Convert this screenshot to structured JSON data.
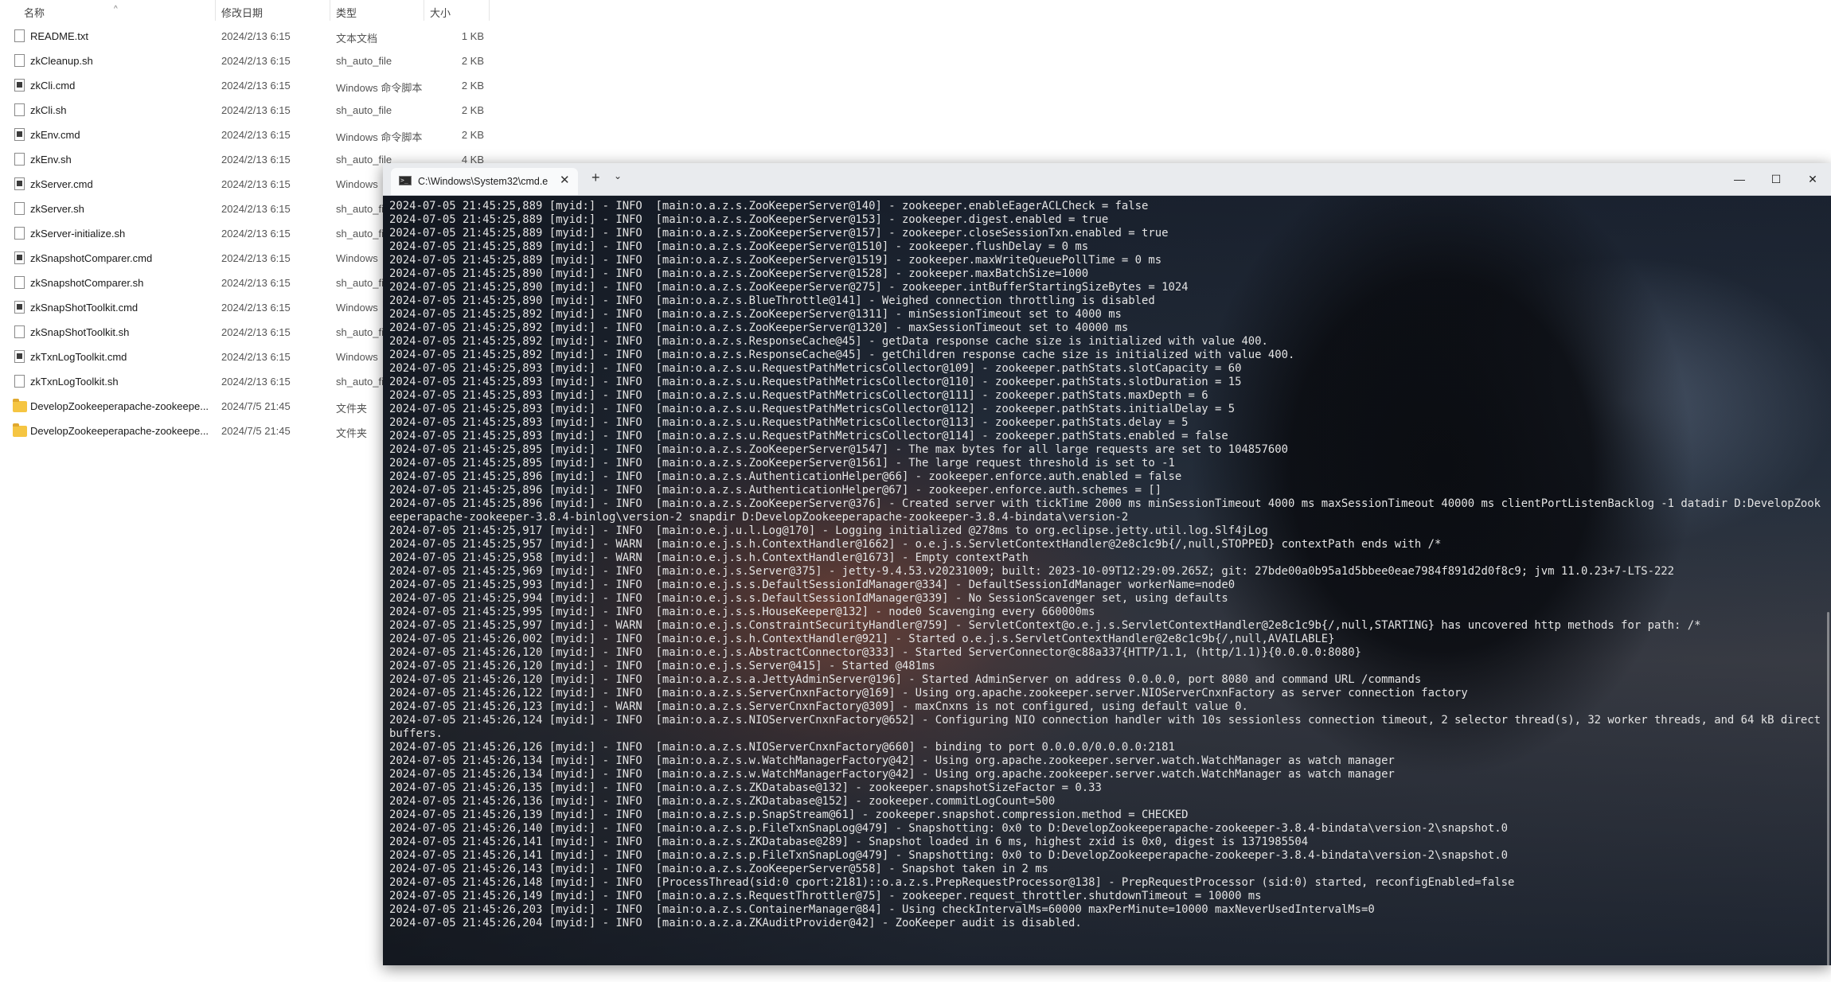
{
  "explorer": {
    "columns": {
      "name": "名称",
      "date": "修改日期",
      "type": "类型",
      "size": "大小"
    },
    "sort_indicator": "^",
    "files": [
      {
        "icon": "text-file-icon",
        "name": "README.txt",
        "date": "2024/2/13 6:15",
        "type": "文本文档",
        "size": "1 KB"
      },
      {
        "icon": "file-icon",
        "name": "zkCleanup.sh",
        "date": "2024/2/13 6:15",
        "type": "sh_auto_file",
        "size": "2 KB"
      },
      {
        "icon": "cmd-file-icon",
        "name": "zkCli.cmd",
        "date": "2024/2/13 6:15",
        "type": "Windows 命令脚本",
        "size": "2 KB"
      },
      {
        "icon": "file-icon",
        "name": "zkCli.sh",
        "date": "2024/2/13 6:15",
        "type": "sh_auto_file",
        "size": "2 KB"
      },
      {
        "icon": "cmd-file-icon",
        "name": "zkEnv.cmd",
        "date": "2024/2/13 6:15",
        "type": "Windows 命令脚本",
        "size": "2 KB"
      },
      {
        "icon": "file-icon",
        "name": "zkEnv.sh",
        "date": "2024/2/13 6:15",
        "type": "sh_auto_file",
        "size": "4 KB"
      },
      {
        "icon": "cmd-file-icon",
        "name": "zkServer.cmd",
        "date": "2024/2/13 6:15",
        "type": "Windows",
        "size": ""
      },
      {
        "icon": "file-icon",
        "name": "zkServer.sh",
        "date": "2024/2/13 6:15",
        "type": "sh_auto_fi",
        "size": ""
      },
      {
        "icon": "file-icon",
        "name": "zkServer-initialize.sh",
        "date": "2024/2/13 6:15",
        "type": "sh_auto_fi",
        "size": ""
      },
      {
        "icon": "cmd-file-icon",
        "name": "zkSnapshotComparer.cmd",
        "date": "2024/2/13 6:15",
        "type": "Windows",
        "size": ""
      },
      {
        "icon": "file-icon",
        "name": "zkSnapshotComparer.sh",
        "date": "2024/2/13 6:15",
        "type": "sh_auto_fi",
        "size": ""
      },
      {
        "icon": "cmd-file-icon",
        "name": "zkSnapShotToolkit.cmd",
        "date": "2024/2/13 6:15",
        "type": "Windows",
        "size": ""
      },
      {
        "icon": "file-icon",
        "name": "zkSnapShotToolkit.sh",
        "date": "2024/2/13 6:15",
        "type": "sh_auto_fi",
        "size": ""
      },
      {
        "icon": "cmd-file-icon",
        "name": "zkTxnLogToolkit.cmd",
        "date": "2024/2/13 6:15",
        "type": "Windows",
        "size": ""
      },
      {
        "icon": "file-icon",
        "name": "zkTxnLogToolkit.sh",
        "date": "2024/2/13 6:15",
        "type": "sh_auto_fi",
        "size": ""
      },
      {
        "icon": "folder-icon",
        "name": "DevelopZookeeperapache-zookeepe...",
        "date": "2024/7/5 21:45",
        "type": "文件夹",
        "size": ""
      },
      {
        "icon": "folder-icon",
        "name": "DevelopZookeeperapache-zookeepe...",
        "date": "2024/7/5 21:45",
        "type": "文件夹",
        "size": ""
      }
    ]
  },
  "terminal": {
    "tab_icon_glyph": ">_",
    "tab_title": "C:\\Windows\\System32\\cmd.e",
    "tab_close": "✕",
    "new_tab": "+",
    "dropdown": "⌄",
    "minimize": "—",
    "maximize": "☐",
    "close": "✕",
    "lines": [
      "2024-07-05 21:45:25,889 [myid:] - INFO  [main:o.a.z.s.ZooKeeperServer@140] - zookeeper.enableEagerACLCheck = false",
      "2024-07-05 21:45:25,889 [myid:] - INFO  [main:o.a.z.s.ZooKeeperServer@153] - zookeeper.digest.enabled = true",
      "2024-07-05 21:45:25,889 [myid:] - INFO  [main:o.a.z.s.ZooKeeperServer@157] - zookeeper.closeSessionTxn.enabled = true",
      "2024-07-05 21:45:25,889 [myid:] - INFO  [main:o.a.z.s.ZooKeeperServer@1510] - zookeeper.flushDelay = 0 ms",
      "2024-07-05 21:45:25,889 [myid:] - INFO  [main:o.a.z.s.ZooKeeperServer@1519] - zookeeper.maxWriteQueuePollTime = 0 ms",
      "2024-07-05 21:45:25,890 [myid:] - INFO  [main:o.a.z.s.ZooKeeperServer@1528] - zookeeper.maxBatchSize=1000",
      "2024-07-05 21:45:25,890 [myid:] - INFO  [main:o.a.z.s.ZooKeeperServer@275] - zookeeper.intBufferStartingSizeBytes = 1024",
      "2024-07-05 21:45:25,890 [myid:] - INFO  [main:o.a.z.s.BlueThrottle@141] - Weighed connection throttling is disabled",
      "2024-07-05 21:45:25,892 [myid:] - INFO  [main:o.a.z.s.ZooKeeperServer@1311] - minSessionTimeout set to 4000 ms",
      "2024-07-05 21:45:25,892 [myid:] - INFO  [main:o.a.z.s.ZooKeeperServer@1320] - maxSessionTimeout set to 40000 ms",
      "2024-07-05 21:45:25,892 [myid:] - INFO  [main:o.a.z.s.ResponseCache@45] - getData response cache size is initialized with value 400.",
      "2024-07-05 21:45:25,892 [myid:] - INFO  [main:o.a.z.s.ResponseCache@45] - getChildren response cache size is initialized with value 400.",
      "2024-07-05 21:45:25,893 [myid:] - INFO  [main:o.a.z.s.u.RequestPathMetricsCollector@109] - zookeeper.pathStats.slotCapacity = 60",
      "2024-07-05 21:45:25,893 [myid:] - INFO  [main:o.a.z.s.u.RequestPathMetricsCollector@110] - zookeeper.pathStats.slotDuration = 15",
      "2024-07-05 21:45:25,893 [myid:] - INFO  [main:o.a.z.s.u.RequestPathMetricsCollector@111] - zookeeper.pathStats.maxDepth = 6",
      "2024-07-05 21:45:25,893 [myid:] - INFO  [main:o.a.z.s.u.RequestPathMetricsCollector@112] - zookeeper.pathStats.initialDelay = 5",
      "2024-07-05 21:45:25,893 [myid:] - INFO  [main:o.a.z.s.u.RequestPathMetricsCollector@113] - zookeeper.pathStats.delay = 5",
      "2024-07-05 21:45:25,893 [myid:] - INFO  [main:o.a.z.s.u.RequestPathMetricsCollector@114] - zookeeper.pathStats.enabled = false",
      "2024-07-05 21:45:25,895 [myid:] - INFO  [main:o.a.z.s.ZooKeeperServer@1547] - The max bytes for all large requests are set to 104857600",
      "2024-07-05 21:45:25,895 [myid:] - INFO  [main:o.a.z.s.ZooKeeperServer@1561] - The large request threshold is set to -1",
      "2024-07-05 21:45:25,896 [myid:] - INFO  [main:o.a.z.s.AuthenticationHelper@66] - zookeeper.enforce.auth.enabled = false",
      "2024-07-05 21:45:25,896 [myid:] - INFO  [main:o.a.z.s.AuthenticationHelper@67] - zookeeper.enforce.auth.schemes = []",
      "2024-07-05 21:45:25,896 [myid:] - INFO  [main:o.a.z.s.ZooKeeperServer@376] - Created server with tickTime 2000 ms minSessionTimeout 4000 ms maxSessionTimeout 40000 ms clientPortListenBacklog -1 datadir D:DevelopZookeeperapache-zookeeper-3.8.4-binlog\\version-2 snapdir D:DevelopZookeeperapache-zookeeper-3.8.4-bindata\\version-2",
      "2024-07-05 21:45:25,917 [myid:] - INFO  [main:o.e.j.u.l.Log@170] - Logging initialized @278ms to org.eclipse.jetty.util.log.Slf4jLog",
      "2024-07-05 21:45:25,957 [myid:] - WARN  [main:o.e.j.s.h.ContextHandler@1662] - o.e.j.s.ServletContextHandler@2e8c1c9b{/,null,STOPPED} contextPath ends with /*",
      "2024-07-05 21:45:25,958 [myid:] - WARN  [main:o.e.j.s.h.ContextHandler@1673] - Empty contextPath",
      "2024-07-05 21:45:25,969 [myid:] - INFO  [main:o.e.j.s.Server@375] - jetty-9.4.53.v20231009; built: 2023-10-09T12:29:09.265Z; git: 27bde00a0b95a1d5bbee0eae7984f891d2d0f8c9; jvm 11.0.23+7-LTS-222",
      "2024-07-05 21:45:25,993 [myid:] - INFO  [main:o.e.j.s.s.DefaultSessionIdManager@334] - DefaultSessionIdManager workerName=node0",
      "2024-07-05 21:45:25,994 [myid:] - INFO  [main:o.e.j.s.s.DefaultSessionIdManager@339] - No SessionScavenger set, using defaults",
      "2024-07-05 21:45:25,995 [myid:] - INFO  [main:o.e.j.s.s.HouseKeeper@132] - node0 Scavenging every 660000ms",
      "2024-07-05 21:45:25,997 [myid:] - WARN  [main:o.e.j.s.ConstraintSecurityHandler@759] - ServletContext@o.e.j.s.ServletContextHandler@2e8c1c9b{/,null,STARTING} has uncovered http methods for path: /*",
      "2024-07-05 21:45:26,002 [myid:] - INFO  [main:o.e.j.s.h.ContextHandler@921] - Started o.e.j.s.ServletContextHandler@2e8c1c9b{/,null,AVAILABLE}",
      "2024-07-05 21:45:26,120 [myid:] - INFO  [main:o.e.j.s.AbstractConnector@333] - Started ServerConnector@c88a337{HTTP/1.1, (http/1.1)}{0.0.0.0:8080}",
      "2024-07-05 21:45:26,120 [myid:] - INFO  [main:o.e.j.s.Server@415] - Started @481ms",
      "2024-07-05 21:45:26,120 [myid:] - INFO  [main:o.a.z.s.a.JettyAdminServer@196] - Started AdminServer on address 0.0.0.0, port 8080 and command URL /commands",
      "2024-07-05 21:45:26,122 [myid:] - INFO  [main:o.a.z.s.ServerCnxnFactory@169] - Using org.apache.zookeeper.server.NIOServerCnxnFactory as server connection factory",
      "2024-07-05 21:45:26,123 [myid:] - WARN  [main:o.a.z.s.ServerCnxnFactory@309] - maxCnxns is not configured, using default value 0.",
      "2024-07-05 21:45:26,124 [myid:] - INFO  [main:o.a.z.s.NIOServerCnxnFactory@652] - Configuring NIO connection handler with 10s sessionless connection timeout, 2 selector thread(s), 32 worker threads, and 64 kB direct buffers.",
      "2024-07-05 21:45:26,126 [myid:] - INFO  [main:o.a.z.s.NIOServerCnxnFactory@660] - binding to port 0.0.0.0/0.0.0.0:2181",
      "2024-07-05 21:45:26,134 [myid:] - INFO  [main:o.a.z.s.w.WatchManagerFactory@42] - Using org.apache.zookeeper.server.watch.WatchManager as watch manager",
      "2024-07-05 21:45:26,134 [myid:] - INFO  [main:o.a.z.s.w.WatchManagerFactory@42] - Using org.apache.zookeeper.server.watch.WatchManager as watch manager",
      "2024-07-05 21:45:26,135 [myid:] - INFO  [main:o.a.z.s.ZKDatabase@132] - zookeeper.snapshotSizeFactor = 0.33",
      "2024-07-05 21:45:26,136 [myid:] - INFO  [main:o.a.z.s.ZKDatabase@152] - zookeeper.commitLogCount=500",
      "2024-07-05 21:45:26,139 [myid:] - INFO  [main:o.a.z.s.p.SnapStream@61] - zookeeper.snapshot.compression.method = CHECKED",
      "2024-07-05 21:45:26,140 [myid:] - INFO  [main:o.a.z.s.p.FileTxnSnapLog@479] - Snapshotting: 0x0 to D:DevelopZookeeperapache-zookeeper-3.8.4-bindata\\version-2\\snapshot.0",
      "2024-07-05 21:45:26,141 [myid:] - INFO  [main:o.a.z.s.ZKDatabase@289] - Snapshot loaded in 6 ms, highest zxid is 0x0, digest is 1371985504",
      "2024-07-05 21:45:26,141 [myid:] - INFO  [main:o.a.z.s.p.FileTxnSnapLog@479] - Snapshotting: 0x0 to D:DevelopZookeeperapache-zookeeper-3.8.4-bindata\\version-2\\snapshot.0",
      "2024-07-05 21:45:26,143 [myid:] - INFO  [main:o.a.z.s.ZooKeeperServer@558] - Snapshot taken in 2 ms",
      "2024-07-05 21:45:26,148 [myid:] - INFO  [ProcessThread(sid:0 cport:2181)::o.a.z.s.PrepRequestProcessor@138] - PrepRequestProcessor (sid:0) started, reconfigEnabled=false",
      "2024-07-05 21:45:26,149 [myid:] - INFO  [main:o.a.z.s.RequestThrottler@75] - zookeeper.request_throttler.shutdownTimeout = 10000 ms",
      "2024-07-05 21:45:26,203 [myid:] - INFO  [main:o.a.z.s.ContainerManager@84] - Using checkIntervalMs=60000 maxPerMinute=10000 maxNeverUsedIntervalMs=0",
      "2024-07-05 21:45:26,204 [myid:] - INFO  [main:o.a.z.a.ZKAuditProvider@42] - ZooKeeper audit is disabled."
    ]
  }
}
